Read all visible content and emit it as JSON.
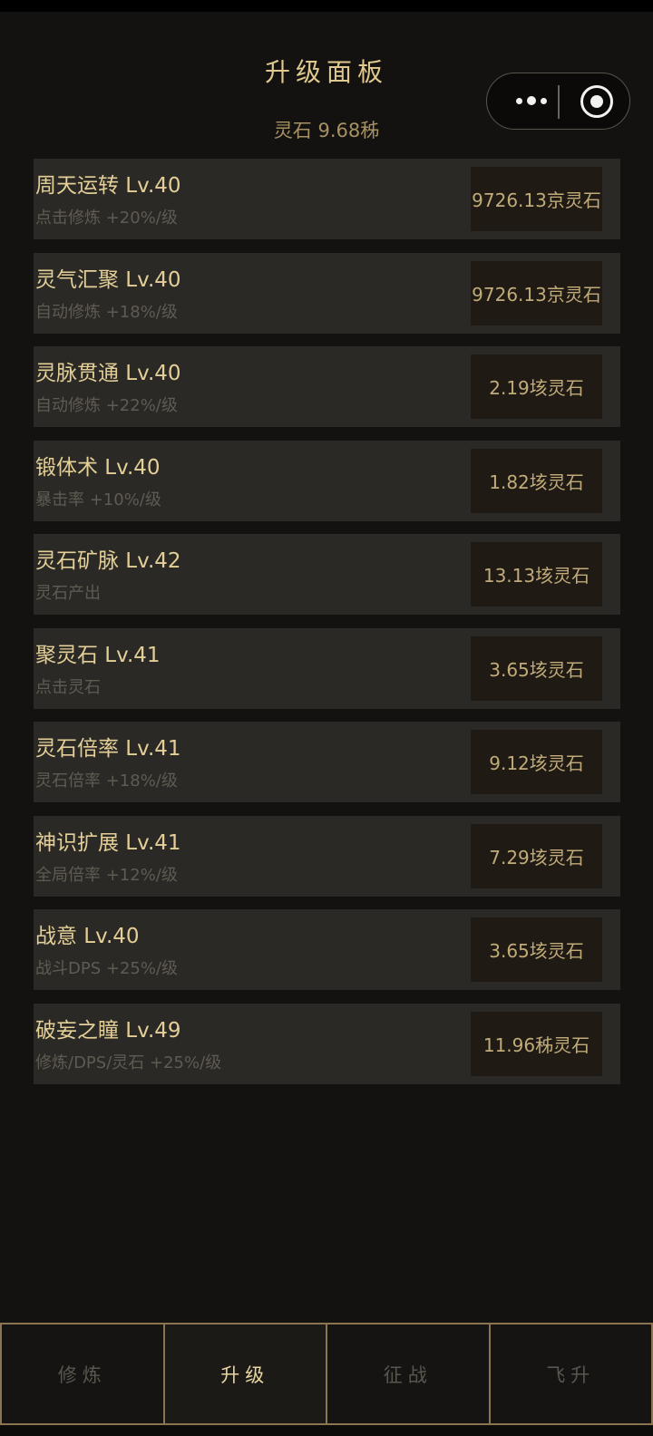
{
  "header": {
    "title": "升级面板",
    "currency": "灵石 9.68秭"
  },
  "upgrades": [
    {
      "name": "周天运转 Lv.40",
      "desc": "点击修炼 +20%/级",
      "cost": "9726.13京灵石"
    },
    {
      "name": "灵气汇聚 Lv.40",
      "desc": "自动修炼 +18%/级",
      "cost": "9726.13京灵石"
    },
    {
      "name": "灵脉贯通 Lv.40",
      "desc": "自动修炼 +22%/级",
      "cost": "2.19垓灵石"
    },
    {
      "name": "锻体术 Lv.40",
      "desc": "暴击率 +10%/级",
      "cost": "1.82垓灵石"
    },
    {
      "name": "灵石矿脉 Lv.42",
      "desc": "灵石产出",
      "cost": "13.13垓灵石"
    },
    {
      "name": "聚灵石 Lv.41",
      "desc": "点击灵石",
      "cost": "3.65垓灵石"
    },
    {
      "name": "灵石倍率 Lv.41",
      "desc": "灵石倍率 +18%/级",
      "cost": "9.12垓灵石"
    },
    {
      "name": "神识扩展 Lv.41",
      "desc": "全局倍率 +12%/级",
      "cost": "7.29垓灵石"
    },
    {
      "name": "战意 Lv.40",
      "desc": "战斗DPS +25%/级",
      "cost": "3.65垓灵石"
    },
    {
      "name": "破妄之瞳 Lv.49",
      "desc": "修炼/DPS/灵石 +25%/级",
      "cost": "11.96秭灵石"
    }
  ],
  "tabs": [
    {
      "label": "修炼",
      "active": false
    },
    {
      "label": "升级",
      "active": true
    },
    {
      "label": "征战",
      "active": false
    },
    {
      "label": "飞升",
      "active": false
    }
  ],
  "capsule": {
    "menu_icon": "more-dots-icon",
    "close_icon": "target-circle-icon"
  },
  "colors": {
    "accent": "#e3cf97",
    "background": "#141210",
    "card": "#2b2925",
    "border": "#8a7550"
  }
}
